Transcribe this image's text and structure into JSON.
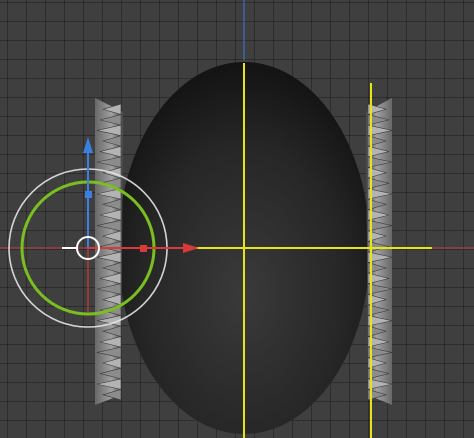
{
  "viewport": {
    "background": "#3f3f3f",
    "grid_color": "#2e2e2e"
  },
  "colors": {
    "sphere_dark": "#161616",
    "sphere_light": "#3a3a3a",
    "guide_yellow": "#e8e612",
    "axis_x_red": "#d83a3a",
    "axis_y_green": "#7bbf1f",
    "axis_z_blue": "#3d7fe0",
    "ring_white": "#e6e6e6",
    "spike_light": "#a8a8a8",
    "spike_dark": "#5a5a5a"
  },
  "gizmo": {
    "type": "transform-gizmo",
    "handles": [
      "move-x-arrow",
      "move-z-arrow",
      "scale-x-cube",
      "scale-z-cube",
      "rotate-ring",
      "trackball-ring",
      "center-handle"
    ]
  },
  "objects": [
    "sphere-mesh",
    "spike-strip-left",
    "spike-strip-right"
  ],
  "guides": [
    "vertical-guide-center",
    "horizontal-guide",
    "vertical-guide-right"
  ]
}
